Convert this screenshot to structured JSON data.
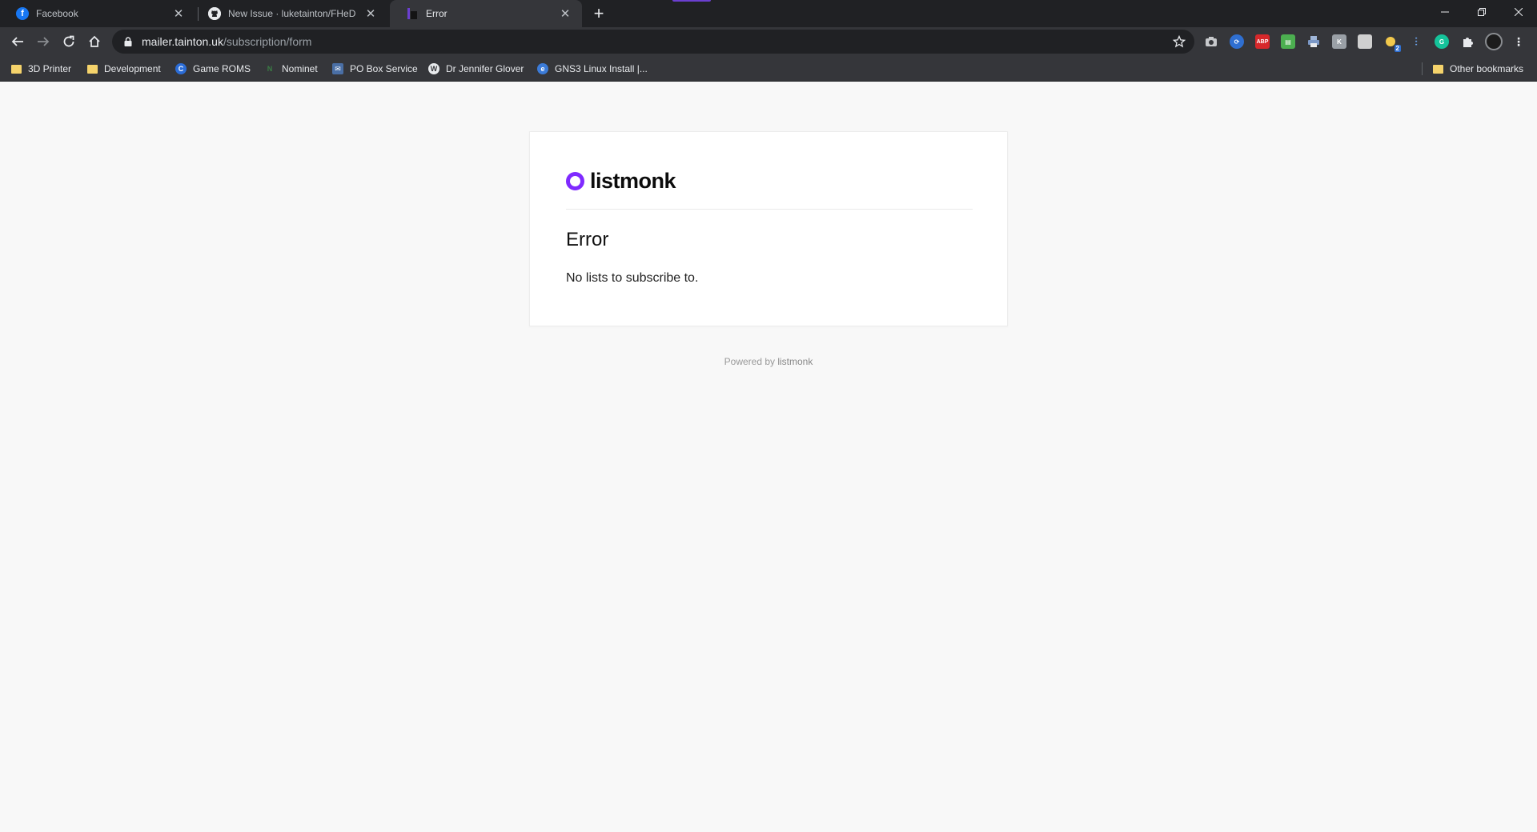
{
  "browser": {
    "tabs": [
      {
        "title": "Facebook",
        "icon": "facebook-icon",
        "active": false
      },
      {
        "title": "New Issue · luketainton/FHeD",
        "icon": "github-icon",
        "active": false
      },
      {
        "title": "Error",
        "icon": "listmonk-icon",
        "active": true
      }
    ],
    "url": {
      "domain": "mailer.tainton.uk",
      "path": "/subscription/form"
    },
    "bookmarks": [
      {
        "label": "3D Printer",
        "icon": "folder-icon"
      },
      {
        "label": "Development",
        "icon": "folder-icon"
      },
      {
        "label": "Game ROMS",
        "icon": "game-roms-icon"
      },
      {
        "label": "Nominet",
        "icon": "nominet-icon"
      },
      {
        "label": "PO Box Service",
        "icon": "po-box-icon"
      },
      {
        "label": "Dr Jennifer Glover",
        "icon": "wordpress-icon"
      },
      {
        "label": "GNS3 Linux Install |...",
        "icon": "gns3-icon"
      }
    ],
    "other_bookmarks": "Other bookmarks",
    "extension_badge": "2"
  },
  "page": {
    "logo_text": "listmonk",
    "error_title": "Error",
    "error_message": "No lists to subscribe to.",
    "footer_prefix": "Powered by ",
    "footer_link": "listmonk"
  },
  "colors": {
    "brand": "#7f2aff",
    "page_bg": "#f8f8f8",
    "chrome_dark": "#202124",
    "chrome_toolbar": "#35363a"
  }
}
